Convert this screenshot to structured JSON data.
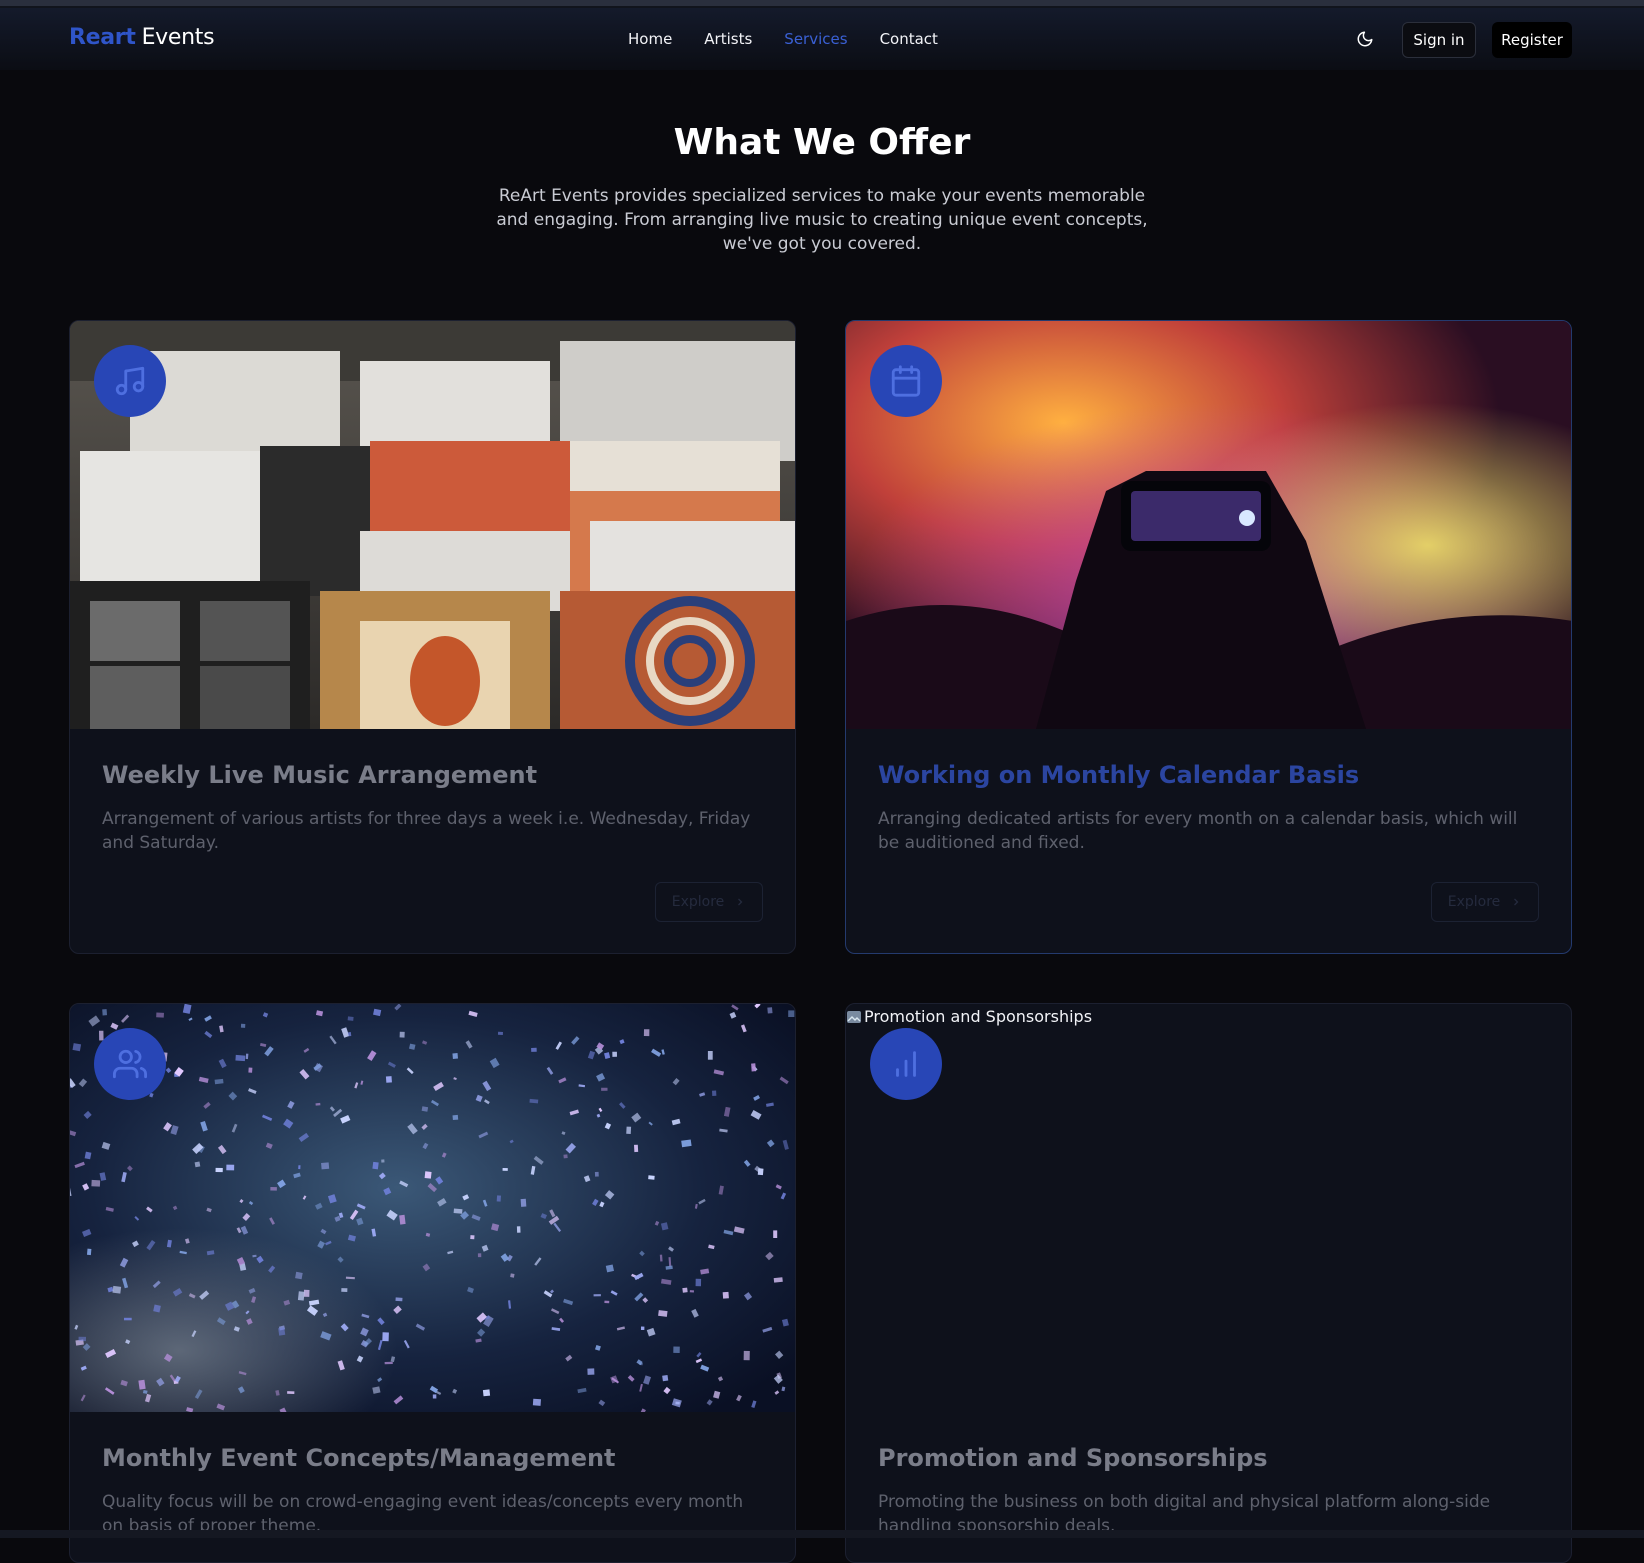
{
  "header": {
    "brand_accent": "Reart",
    "brand_rest": "Events",
    "nav": [
      {
        "label": "Home",
        "active": false
      },
      {
        "label": "Artists",
        "active": false
      },
      {
        "label": "Services",
        "active": true
      },
      {
        "label": "Contact",
        "active": false
      }
    ],
    "theme_toggle_icon": "moon-icon",
    "signin_label": "Sign in",
    "register_label": "Register"
  },
  "section": {
    "title": "What We Offer",
    "subtitle": "ReArt Events provides specialized services to make your events memorable and engaging. From arranging live music to creating unique event concepts, we've got you covered."
  },
  "services": [
    {
      "icon": "music-notes-icon",
      "image": "record-store-vinyl-photo",
      "title": "Weekly Live Music Arrangement",
      "description": "Arrangement of various artists for three days a week i.e. Wednesday, Friday and Saturday.",
      "button": "Explore"
    },
    {
      "icon": "calendar-icon",
      "image": "concert-crowd-phone-photo",
      "title": "Working on Monthly Calendar Basis",
      "description": "Arranging dedicated artists for every month on a calendar basis, which will be auditioned and fixed.",
      "button": "Explore"
    },
    {
      "icon": "users-icon",
      "image": "confetti-photo",
      "title": "Monthly Event Concepts/Management",
      "description": "Quality focus will be on crowd-engaging event ideas/concepts every month on basis of proper theme."
    },
    {
      "icon": "bar-chart-icon",
      "image_alt": "Promotion and Sponsorships",
      "title": "Promotion and Sponsorships",
      "description": "Promoting the business on both digital and physical platform along-side handling sponsorship deals."
    }
  ],
  "colors": {
    "accent": "#2f55c9",
    "background": "#09090d",
    "card": "#0e111b",
    "badge": "#2846b6"
  }
}
